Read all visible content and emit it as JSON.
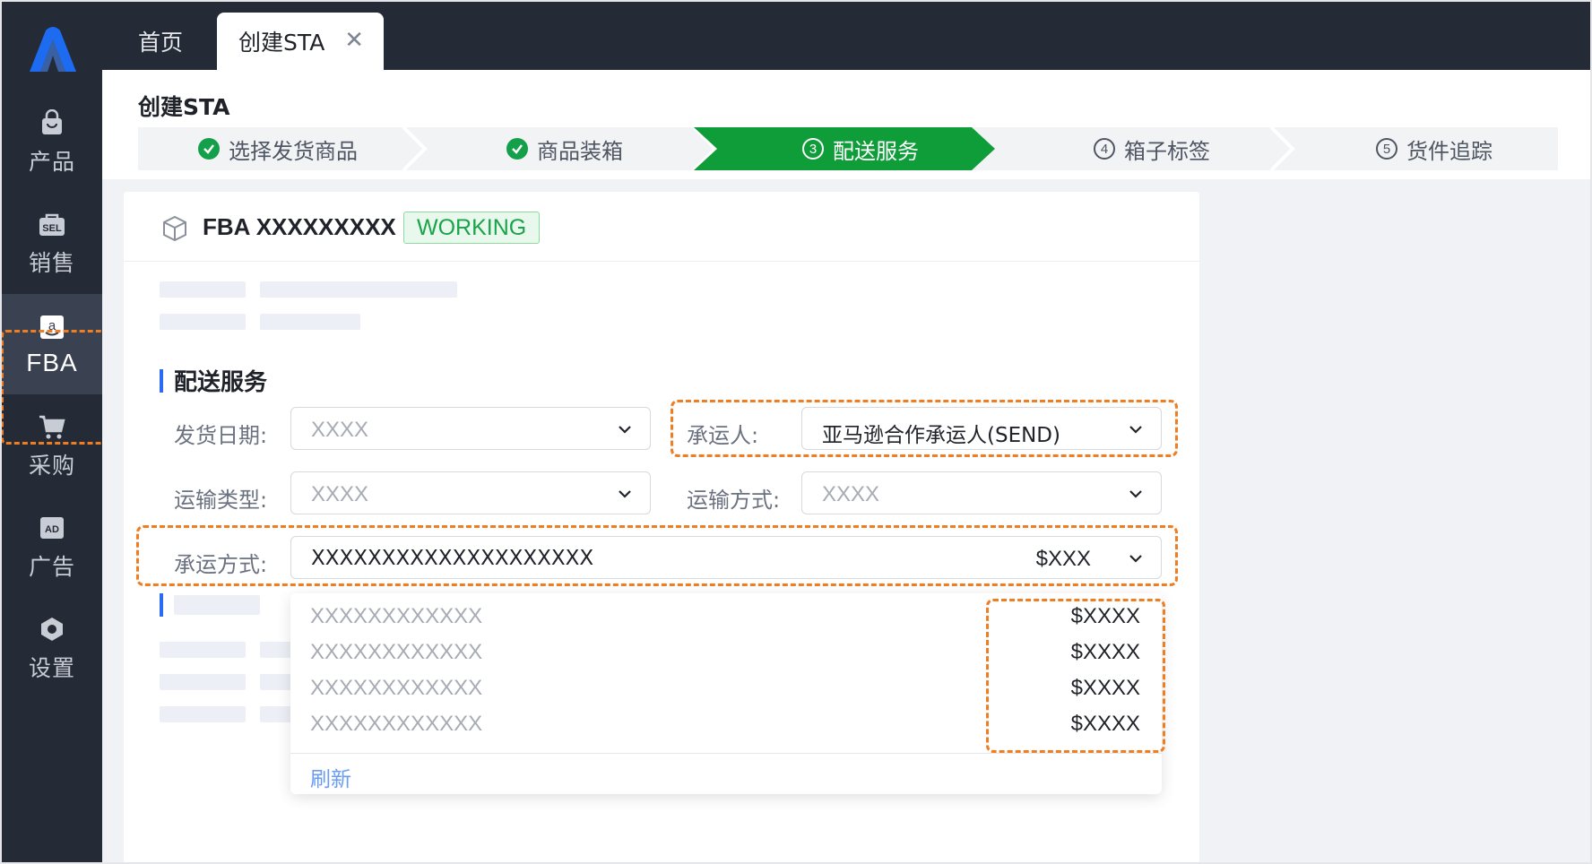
{
  "app": {
    "tabs": [
      {
        "label": "首页"
      },
      {
        "label": "创建STA",
        "close": "✕"
      }
    ],
    "page_title": "创建STA"
  },
  "sidebar": {
    "items": [
      {
        "label": "产品",
        "icon": "bag-icon"
      },
      {
        "label": "销售",
        "icon": "sel-tag-icon"
      },
      {
        "label": "FBA",
        "icon": "amazon-icon",
        "active": true
      },
      {
        "label": "采购",
        "icon": "cart-icon"
      },
      {
        "label": "广告",
        "icon": "ad-icon"
      },
      {
        "label": "设置",
        "icon": "gear-hex-icon"
      }
    ]
  },
  "steps": [
    {
      "label": "选择发货商品",
      "state": "done"
    },
    {
      "label": "商品装箱",
      "state": "done"
    },
    {
      "label": "配送服务",
      "state": "active",
      "num": "3"
    },
    {
      "label": "箱子标签",
      "state": "todo",
      "num": "4"
    },
    {
      "label": "货件追踪",
      "state": "todo",
      "num": "5"
    }
  ],
  "shipment": {
    "id": "FBA XXXXXXXXX",
    "status": "WORKING"
  },
  "shipping": {
    "section_title": "配送服务",
    "ship_date": {
      "label": "发货日期:",
      "value": "XXXX"
    },
    "carrier": {
      "label": "承运人:",
      "value": "亚马逊合作承运人(SEND)"
    },
    "transport_type": {
      "label": "运输类型:",
      "value": "XXXX"
    },
    "transport_mode": {
      "label": "运输方式:",
      "value": "XXXX"
    },
    "carrier_method": {
      "label": "承运方式:",
      "value": "XXXXXXXXXXXXXXXXXXXX",
      "price": "$XXX"
    }
  },
  "dropdown": {
    "options": [
      {
        "name": "XXXXXXXXXXXX",
        "price": "$XXXX"
      },
      {
        "name": "XXXXXXXXXXXX",
        "price": "$XXXX"
      },
      {
        "name": "XXXXXXXXXXXX",
        "price": "$XXXX"
      },
      {
        "name": "XXXXXXXXXXXX",
        "price": "$XXXX"
      }
    ],
    "refresh": "刷新"
  },
  "colors": {
    "sidebar_bg": "#242a36",
    "step_active": "#0f9d3a",
    "highlight": "#ef7d22",
    "accent": "#2a6bf2"
  }
}
